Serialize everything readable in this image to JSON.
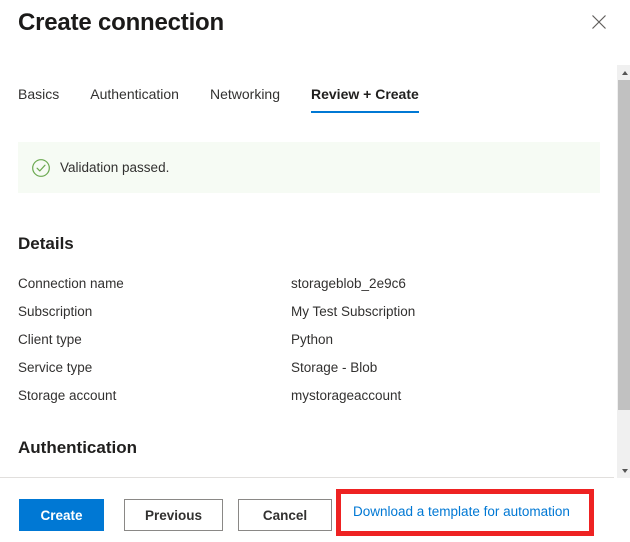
{
  "header": {
    "title": "Create connection",
    "close_icon": "close-icon"
  },
  "tabs": [
    {
      "label": "Basics",
      "active": false
    },
    {
      "label": "Authentication",
      "active": false
    },
    {
      "label": "Networking",
      "active": false
    },
    {
      "label": "Review + Create",
      "active": true
    }
  ],
  "validation": {
    "icon": "check-circle-icon",
    "message": "Validation passed.",
    "background": "#f6fbf4",
    "icon_color": "#6aa84f"
  },
  "sections": {
    "details_heading": "Details",
    "authentication_heading": "Authentication"
  },
  "details": [
    {
      "key": "Connection name",
      "value": "storageblob_2e9c6"
    },
    {
      "key": "Subscription",
      "value": "My Test Subscription"
    },
    {
      "key": "Client type",
      "value": "Python"
    },
    {
      "key": "Service type",
      "value": "Storage - Blob"
    },
    {
      "key": "Storage account",
      "value": "mystorageaccount"
    }
  ],
  "scrollbar": {
    "up_arrow_icon": "chevron-up-icon",
    "down_arrow_icon": "chevron-down-icon"
  },
  "footer": {
    "create_label": "Create",
    "previous_label": "Previous",
    "cancel_label": "Cancel",
    "template_link_label": "Download a template for automation"
  },
  "annotation": {
    "highlight_color": "#ee2222"
  },
  "colors": {
    "accent": "#0078d4",
    "text": "#323130",
    "success": "#6aa84f"
  }
}
